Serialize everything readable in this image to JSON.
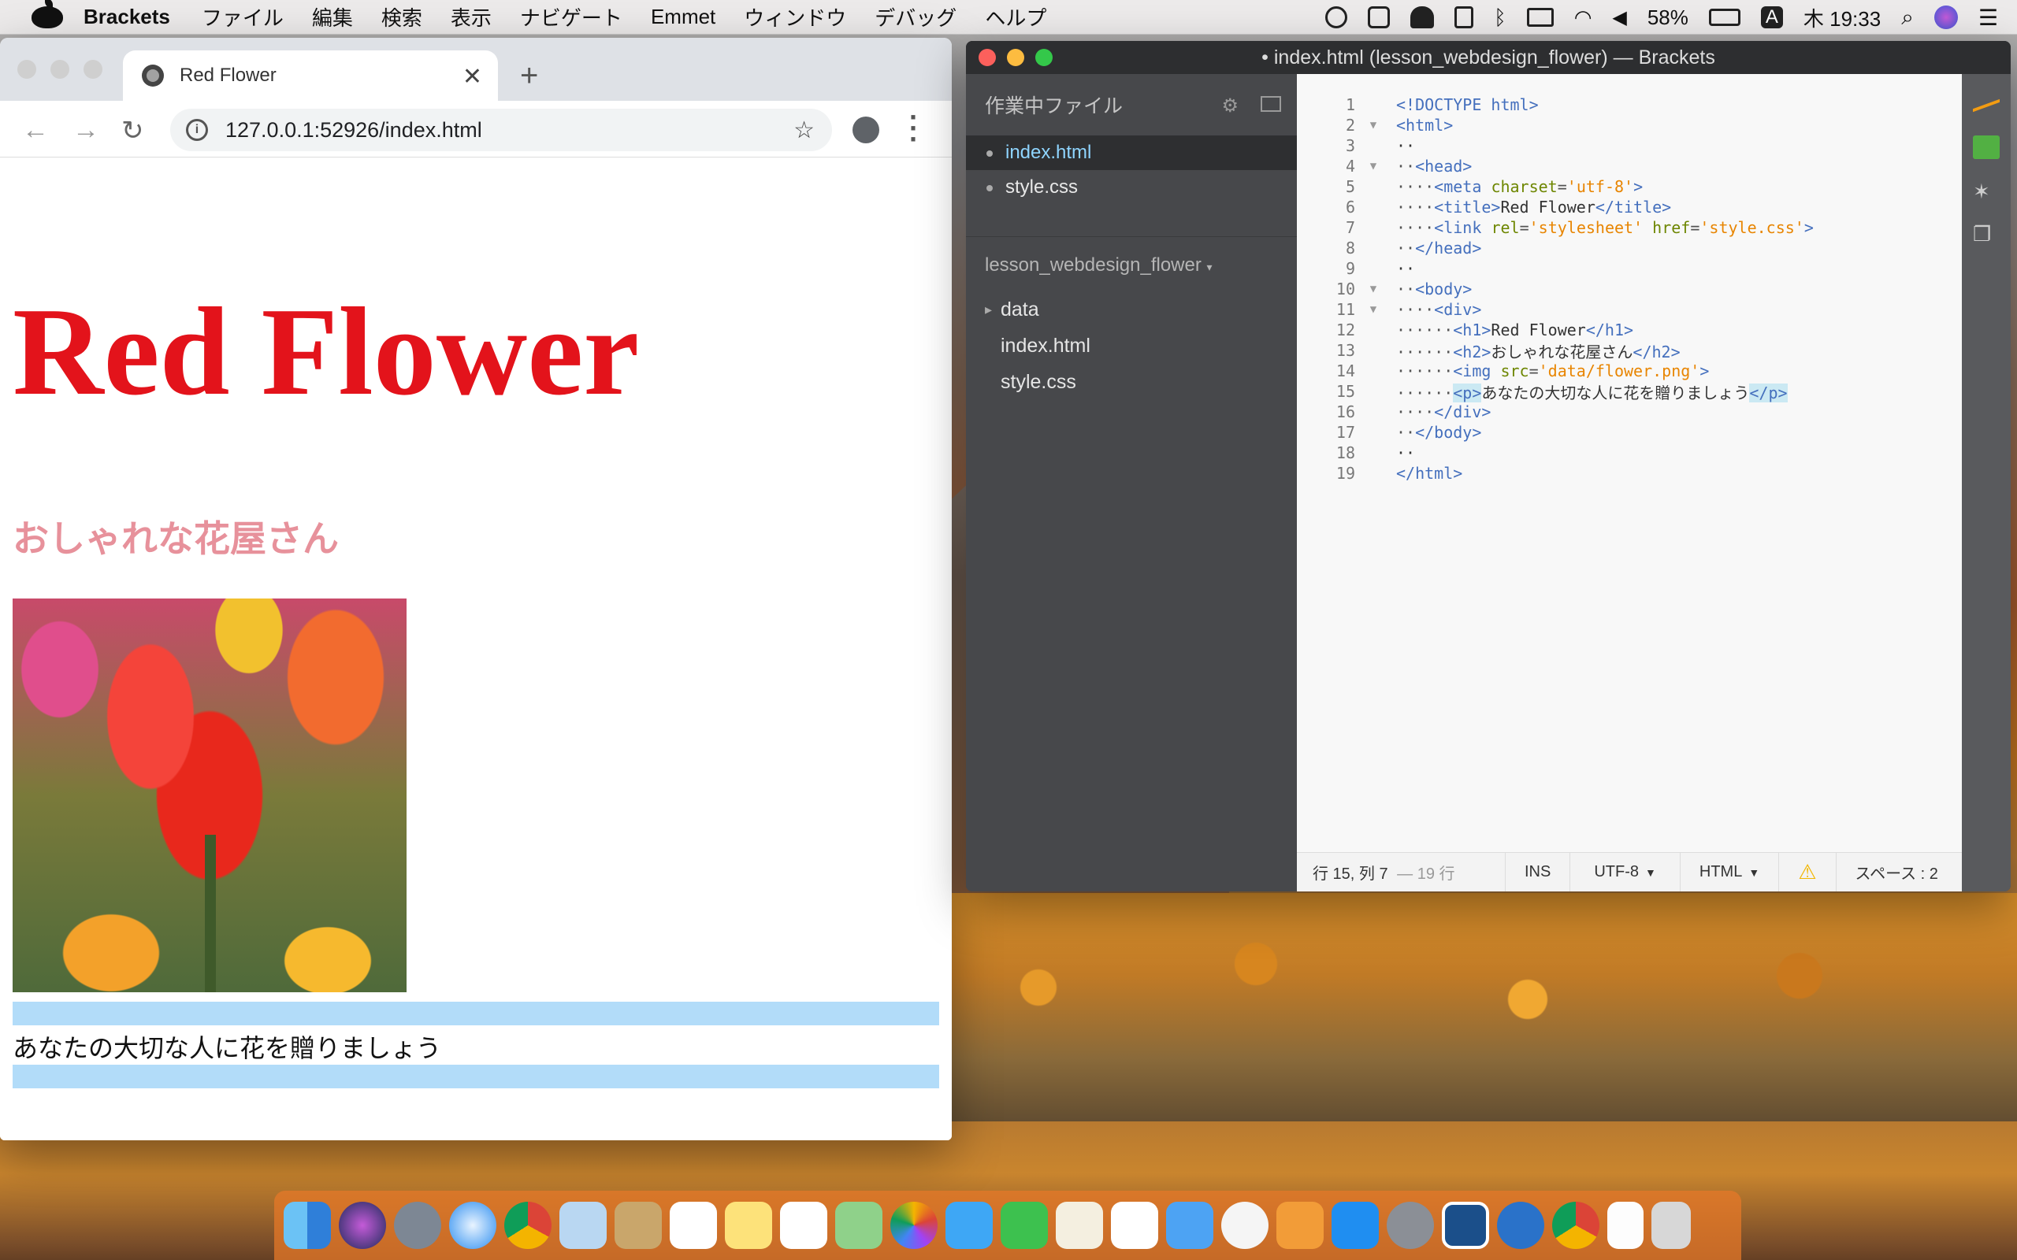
{
  "menubar": {
    "app_name": "Brackets",
    "items": [
      "ファイル",
      "編集",
      "検索",
      "表示",
      "ナビゲート",
      "Emmet",
      "ウィンドウ",
      "デバッグ",
      "ヘルプ"
    ],
    "battery": "58%",
    "input_mode": "A",
    "clock": "木 19:33"
  },
  "browser": {
    "tab_title": "Red Flower",
    "url": "127.0.0.1:52926/index.html",
    "page": {
      "h1": "Red Flower",
      "h2": "おしゃれな花屋さん",
      "paragraph": "あなたの大切な人に花を贈りましょう"
    }
  },
  "brackets": {
    "window_title": "• index.html (lesson_webdesign_flower) — Brackets",
    "working_files_label": "作業中ファイル",
    "working_files": [
      "index.html",
      "style.css"
    ],
    "project_name": "lesson_webdesign_flower",
    "tree": [
      "data",
      "index.html",
      "style.css"
    ],
    "status": {
      "position": "行 15, 列 7",
      "lines": "— 19 行",
      "mode": "INS",
      "encoding": "UTF-8",
      "language": "HTML",
      "spaces": "スペース : 2"
    }
  },
  "code_lines": [
    {
      "n": "1",
      "fold": "",
      "html": "<span class=\"tag\">&lt;!DOCTYPE html&gt;</span>"
    },
    {
      "n": "2",
      "fold": "▼",
      "html": "<span class=\"tag\">&lt;html&gt;</span>"
    },
    {
      "n": "3",
      "fold": "",
      "html": "<span class=\"txt\">··</span>"
    },
    {
      "n": "4",
      "fold": "▼",
      "html": "··<span class=\"tag\">&lt;head&gt;</span>"
    },
    {
      "n": "5",
      "fold": "",
      "html": "····<span class=\"tag\">&lt;meta</span> <span class=\"attr\">charset</span>=<span class=\"val\">'utf-8'</span><span class=\"tag\">&gt;</span>"
    },
    {
      "n": "6",
      "fold": "",
      "html": "····<span class=\"tag\">&lt;title&gt;</span><span class=\"txt\">Red Flower</span><span class=\"tag\">&lt;/title&gt;</span>"
    },
    {
      "n": "7",
      "fold": "",
      "html": "····<span class=\"tag\">&lt;link</span> <span class=\"attr\">rel</span>=<span class=\"val\">'stylesheet'</span> <span class=\"attr\">href</span>=<span class=\"val\">'style.css'</span><span class=\"tag\">&gt;</span>"
    },
    {
      "n": "8",
      "fold": "",
      "html": "··<span class=\"tag\">&lt;/head&gt;</span>"
    },
    {
      "n": "9",
      "fold": "",
      "html": "<span class=\"txt\">··</span>"
    },
    {
      "n": "10",
      "fold": "▼",
      "html": "··<span class=\"tag\">&lt;body&gt;</span>"
    },
    {
      "n": "11",
      "fold": "▼",
      "html": "····<span class=\"tag\">&lt;div&gt;</span>"
    },
    {
      "n": "12",
      "fold": "",
      "html": "······<span class=\"tag\">&lt;h1&gt;</span><span class=\"txt\">Red Flower</span><span class=\"tag\">&lt;/h1&gt;</span>"
    },
    {
      "n": "13",
      "fold": "",
      "html": "······<span class=\"tag\">&lt;h2&gt;</span><span class=\"txt\">おしゃれな花屋さん</span><span class=\"tag\">&lt;/h2&gt;</span>"
    },
    {
      "n": "14",
      "fold": "",
      "html": "······<span class=\"tag\">&lt;img</span> <span class=\"attr\">src</span>=<span class=\"val\">'data/flower.png'</span><span class=\"tag\">&gt;</span>"
    },
    {
      "n": "15",
      "fold": "",
      "html": "······<span class=\"tag hl\">&lt;p&gt;</span><span class=\"txt\">あなたの大切な人に花を贈りましょう</span><span class=\"tag hl\">&lt;/p&gt;</span>"
    },
    {
      "n": "16",
      "fold": "",
      "html": "····<span class=\"tag\">&lt;/div&gt;</span>"
    },
    {
      "n": "17",
      "fold": "",
      "html": "··<span class=\"tag\">&lt;/body&gt;</span>"
    },
    {
      "n": "18",
      "fold": "",
      "html": "<span class=\"txt\">··</span>"
    },
    {
      "n": "19",
      "fold": "",
      "html": "<span class=\"tag\">&lt;/html&gt;</span>"
    }
  ]
}
